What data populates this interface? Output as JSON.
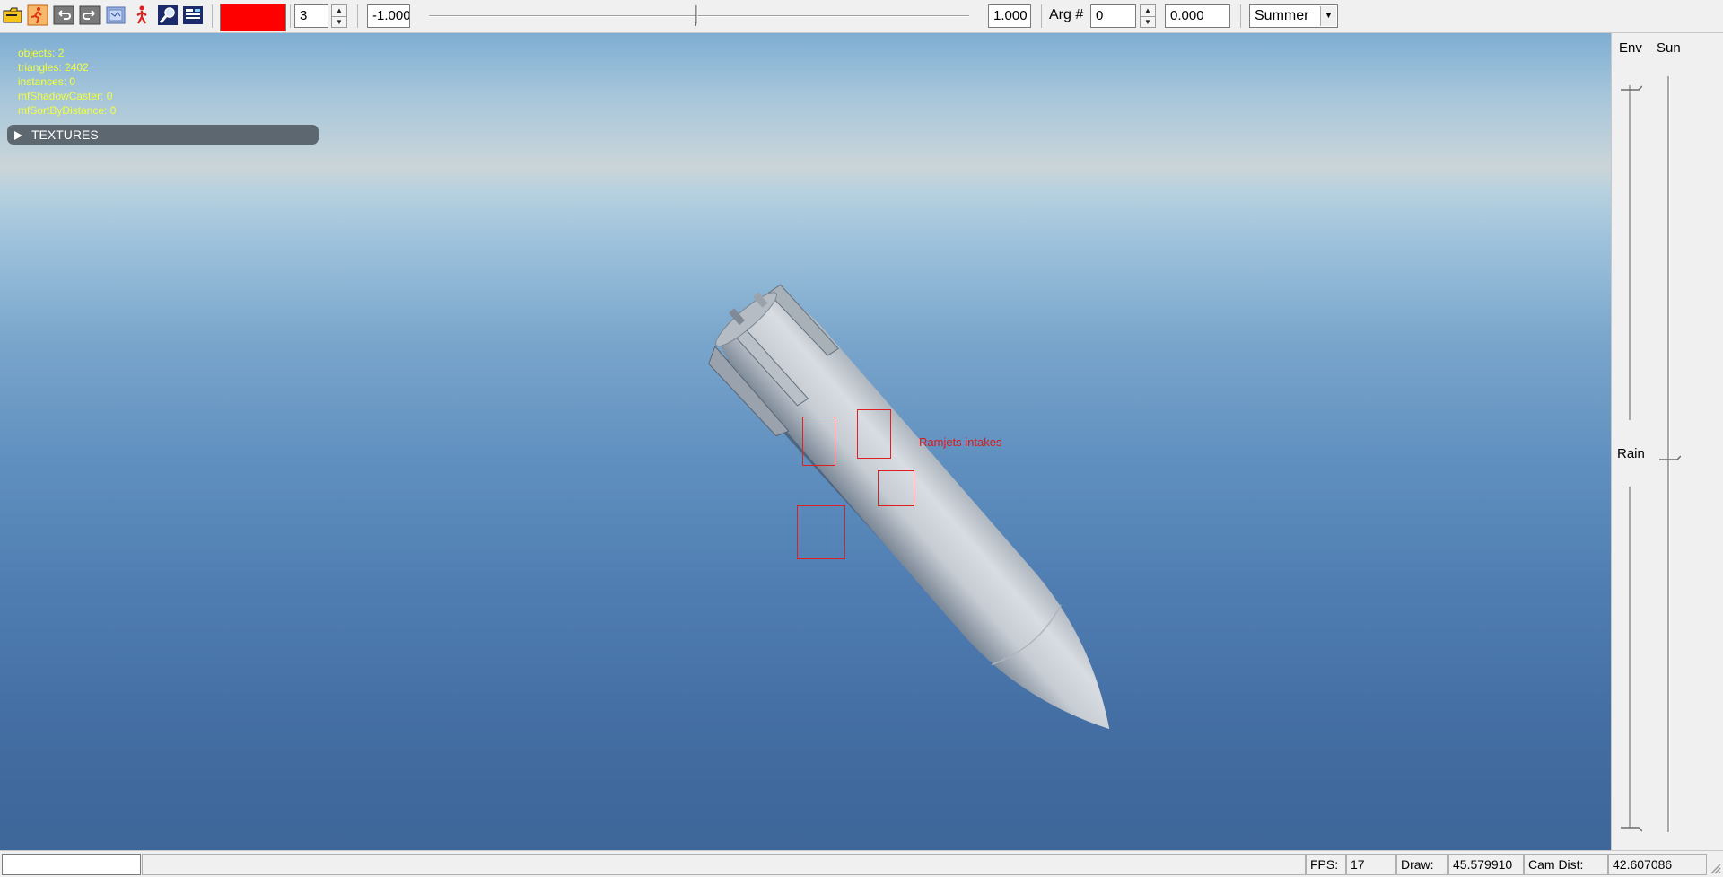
{
  "toolbar": {
    "icons": [
      "open-folder-icon",
      "run-man-icon",
      "undo-icon",
      "redo-icon",
      "image-icon",
      "animate-man-icon",
      "zoom-icon",
      "list-icon"
    ],
    "color_swatch": "#ff0000",
    "count_value": "3",
    "min_value": "-1.000",
    "slider_fraction": 0.5,
    "max_value": "1.000",
    "arg_label": "Arg #",
    "arg_value": "0",
    "arg_float": "0.000",
    "season": "Summer"
  },
  "viewport": {
    "stats": [
      "objects: 2",
      "triangles: 2402",
      "instances: 0",
      "mfShadowCaster: 0",
      "mfSortByDistance: 0"
    ],
    "textures_label": "TEXTURES",
    "annotation_label": "Ramjets intakes",
    "annotation_color": "#e01818"
  },
  "right_panel": {
    "env_label": "Env",
    "sun_label": "Sun",
    "rain_label": "Rain"
  },
  "statusbar": {
    "fps_label": "FPS:",
    "fps_value": "17",
    "draw_label": "Draw:",
    "draw_value": "45.579910",
    "camdist_label": "Cam Dist:",
    "camdist_value": "42.607086"
  }
}
